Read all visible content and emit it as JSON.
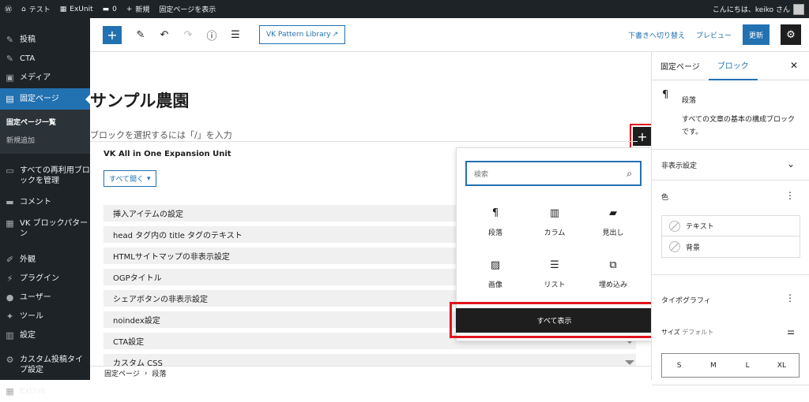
{
  "adminbar": {
    "site_name": "テスト",
    "exunit": "ExUnit",
    "comments": "0",
    "new": "新規",
    "view_page": "固定ページを表示",
    "greeting": "こんにちは、keiko さん"
  },
  "menu": {
    "posts": "投稿",
    "cta": "CTA",
    "media": "メディア",
    "pages": "固定ページ",
    "pages_all": "固定ページ一覧",
    "pages_new": "新規追加",
    "reusable": "すべての再利用ブロックを管理",
    "comments": "コメント",
    "vk_patterns": "VK ブロックパターン",
    "appearance": "外観",
    "plugins": "プラグイン",
    "users": "ユーザー",
    "tools": "ツール",
    "settings": "設定",
    "custom_post": "カスタム投稿タイプ設定",
    "exunit": "ExUnit"
  },
  "toolbar": {
    "pattern_library": "VK Pattern Library",
    "switch_draft": "下書きへ切り替え",
    "preview": "プレビュー",
    "update": "更新"
  },
  "editor": {
    "title": "サンプル農園",
    "placeholder": "ブロックを選択するには「/」を入力",
    "exunit_title": "VK All in One Expansion Unit",
    "open_all": "すべて開く",
    "accordions": [
      "挿入アイテムの設定",
      "head タグ内の title タグのテキスト",
      "HTMLサイトマップの非表示設定",
      "OGPタイトル",
      "シェアボタンの非表示設定",
      "noindex設定",
      "CTA設定",
      "カスタム CSS"
    ]
  },
  "breadcrumb": {
    "root": "固定ページ",
    "sep": "›",
    "current": "段落"
  },
  "inserter": {
    "search_placeholder": "検索",
    "items": [
      "段落",
      "カラム",
      "見出し",
      "画像",
      "リスト",
      "埋め込み"
    ],
    "show_all": "すべて表示"
  },
  "sidebar": {
    "tab_page": "固定ページ",
    "tab_block": "ブロック",
    "block_name": "段落",
    "block_desc": "すべての文章の基本の構成ブロックです。",
    "hide_settings": "非表示設定",
    "color": "色",
    "color_text": "テキスト",
    "color_bg": "背景",
    "typography": "タイポグラフィ",
    "size_label": "サイズ",
    "size_value": "デフォルト",
    "sizes": [
      "S",
      "M",
      "L",
      "XL"
    ]
  },
  "colors": {
    "admin_dark": "#1d2327",
    "accent": "#2271b1",
    "highlight": "#e0141e"
  }
}
